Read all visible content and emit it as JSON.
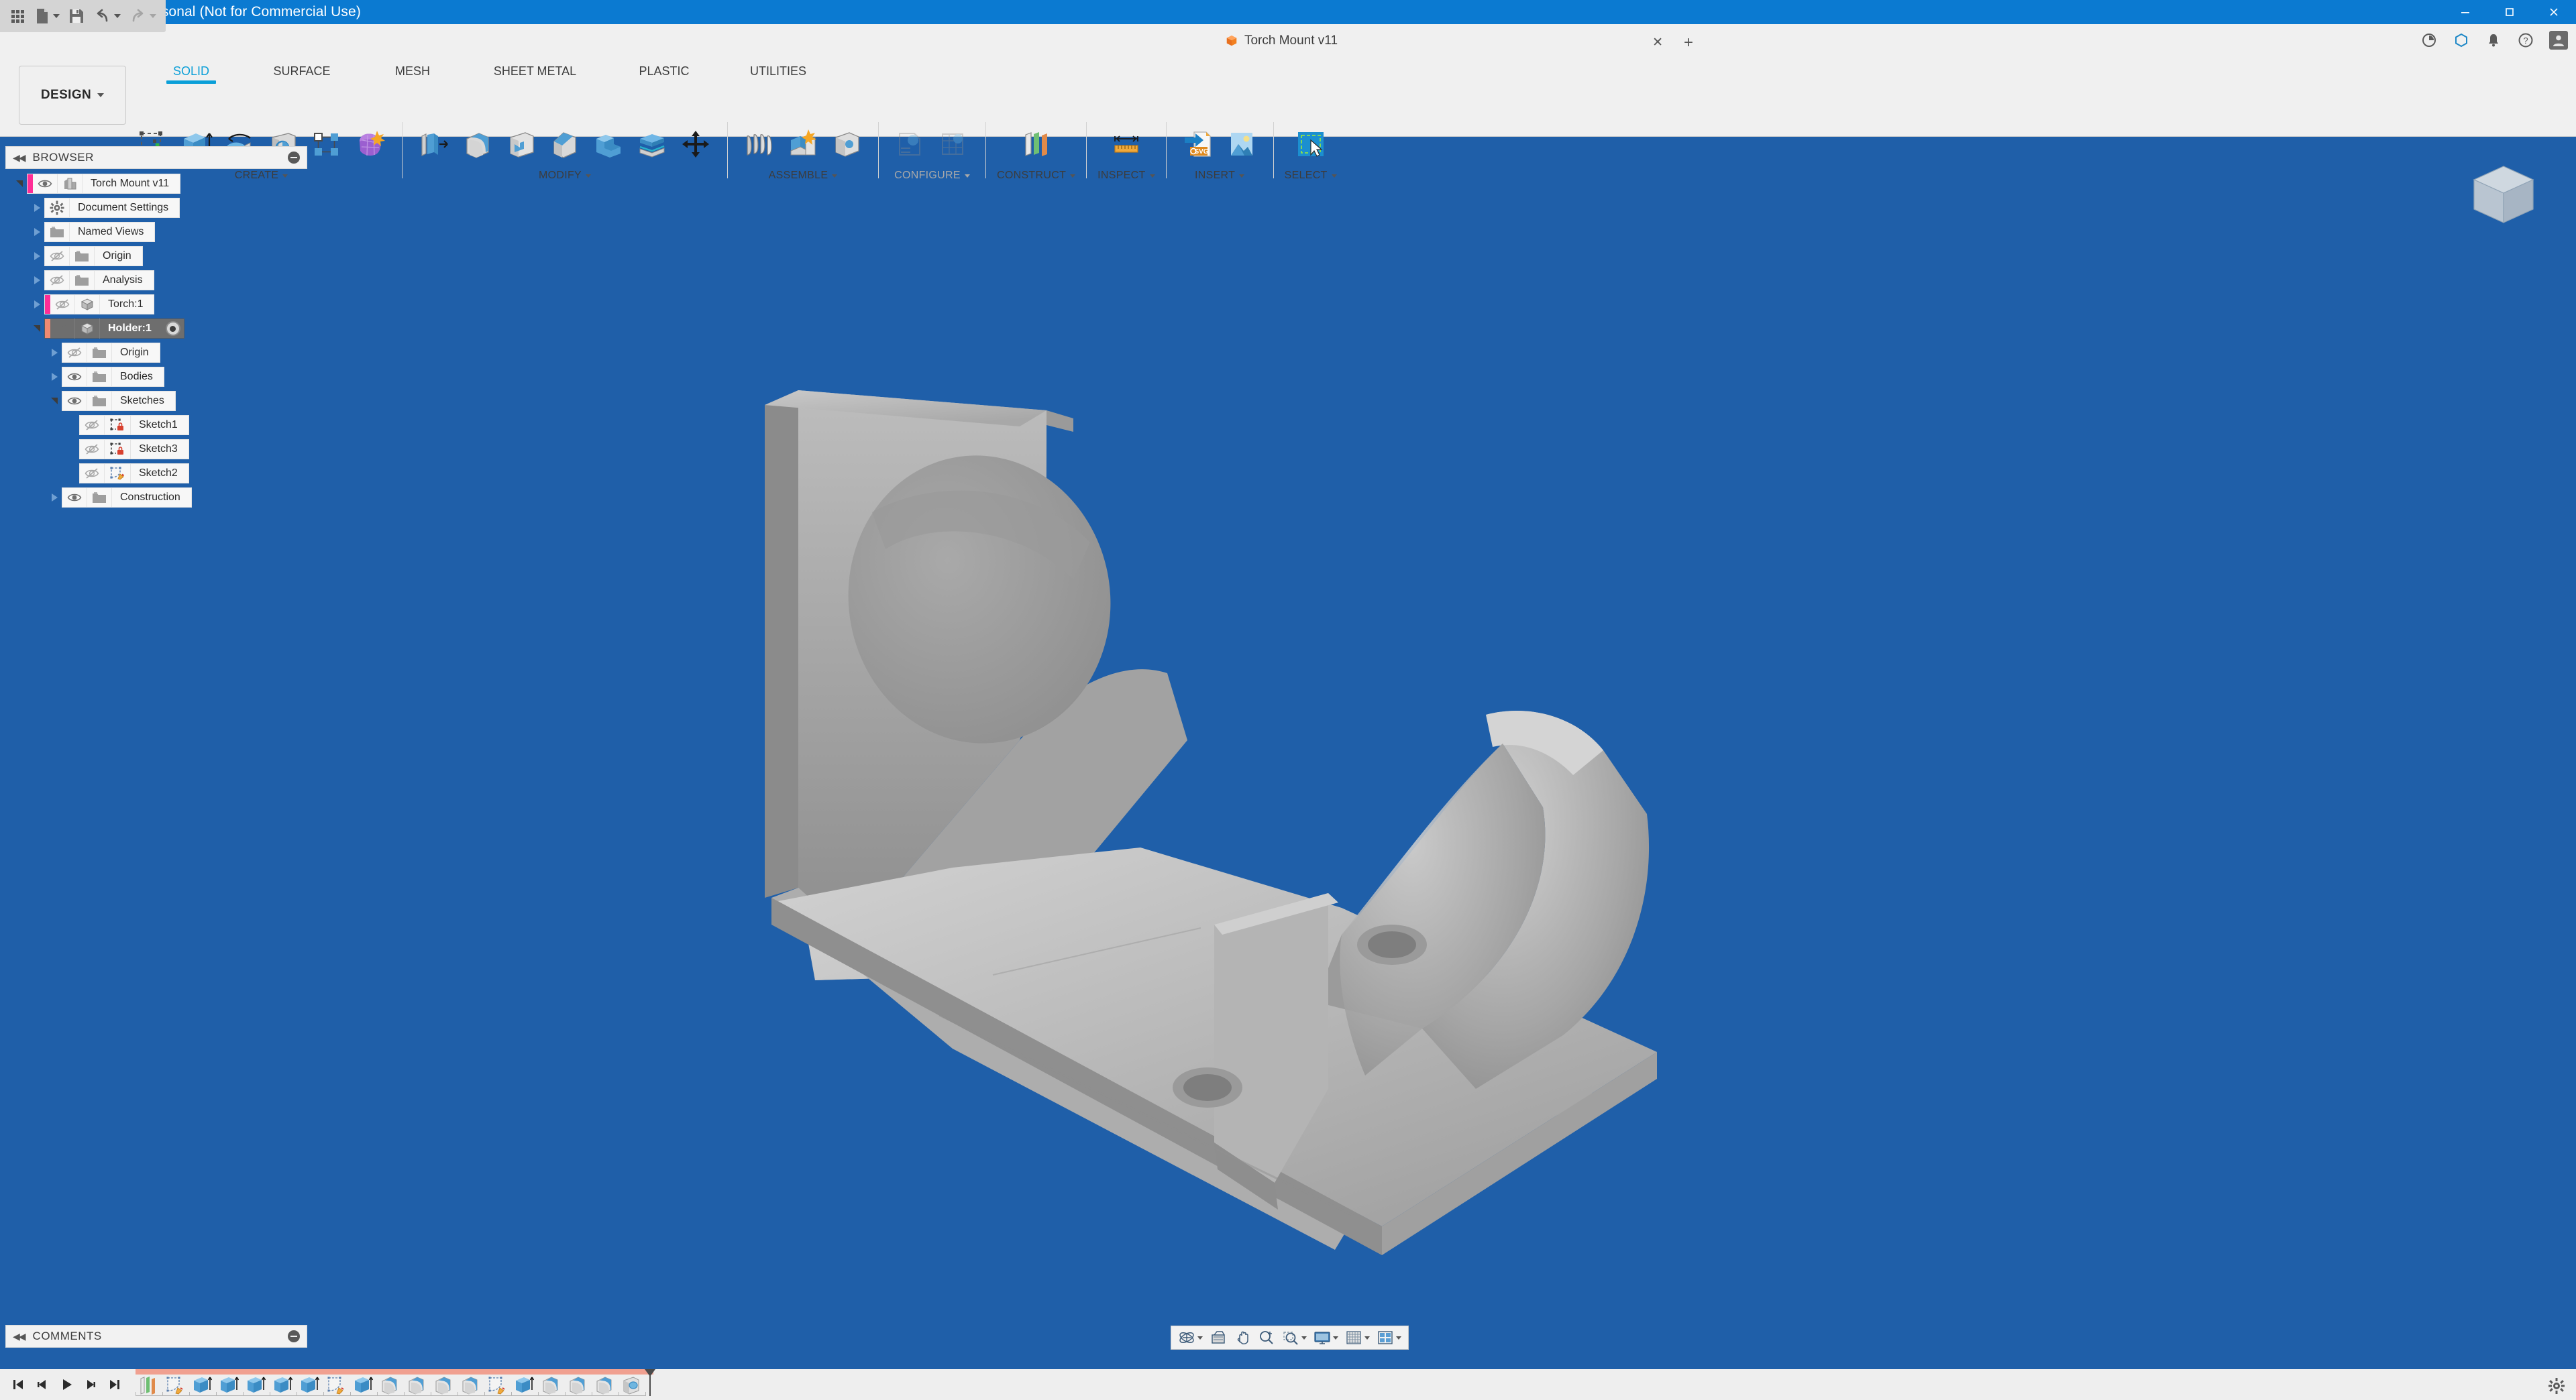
{
  "window": {
    "title": "Autodesk Fusion Personal (Not for Commercial Use)",
    "app_icon": "fusion-logo-icon",
    "minimize": "–",
    "maximize": "□",
    "close": "✕"
  },
  "quick_access": {
    "items": [
      {
        "name": "app-grid-button",
        "icon": "grid-menu-icon",
        "has_caret": false
      },
      {
        "name": "new-file-button",
        "icon": "file-icon",
        "has_caret": true
      },
      {
        "name": "save-button",
        "icon": "save-disk-icon",
        "has_caret": false
      },
      {
        "name": "undo-button",
        "icon": "undo-arrow-icon",
        "has_caret": true
      },
      {
        "name": "redo-button",
        "icon": "redo-arrow-icon",
        "has_caret": true
      }
    ]
  },
  "document_tab": {
    "label": "Torch Mount v11",
    "icon": "orange-cube-icon",
    "close_glyph": "✕",
    "add_glyph": "+"
  },
  "appbar_right": {
    "items": [
      {
        "name": "job-status-icon",
        "glyph": "◔"
      },
      {
        "name": "extensions-icon",
        "glyph": "⬡"
      },
      {
        "name": "notifications-bell-icon",
        "glyph": "🔔"
      },
      {
        "name": "help-icon",
        "glyph": "?"
      },
      {
        "name": "user-avatar",
        "glyph": "👤"
      }
    ]
  },
  "workspace_selector": {
    "label": "DESIGN"
  },
  "ribbon": {
    "tabs": [
      {
        "label": "SOLID",
        "active": true
      },
      {
        "label": "SURFACE",
        "active": false
      },
      {
        "label": "MESH",
        "active": false
      },
      {
        "label": "SHEET METAL",
        "active": false
      },
      {
        "label": "PLASTIC",
        "active": false
      },
      {
        "label": "UTILITIES",
        "active": false
      }
    ],
    "panels": [
      {
        "label": "CREATE",
        "dimmed": false,
        "tools": [
          {
            "name": "create-sketch-tool",
            "icon": "sketch-plus-icon"
          },
          {
            "name": "extrude-tool",
            "icon": "extrude-icon"
          },
          {
            "name": "revolve-tool",
            "icon": "revolve-icon"
          },
          {
            "name": "hole-tool",
            "icon": "hole-icon"
          },
          {
            "name": "rectangular-pattern-tool",
            "icon": "pattern-icon"
          },
          {
            "name": "create-form-tool",
            "icon": "form-sculpt-icon"
          }
        ]
      },
      {
        "label": "MODIFY",
        "dimmed": false,
        "tools": [
          {
            "name": "press-pull-tool",
            "icon": "press-pull-icon"
          },
          {
            "name": "fillet-tool",
            "icon": "fillet-icon"
          },
          {
            "name": "shell-tool",
            "icon": "shell-icon"
          },
          {
            "name": "chamfer-tool",
            "icon": "chamfer-icon"
          },
          {
            "name": "combine-tool",
            "icon": "combine-icon"
          },
          {
            "name": "split-body-tool",
            "icon": "split-body-icon"
          },
          {
            "name": "move-copy-tool",
            "icon": "move-arrows-icon"
          }
        ]
      },
      {
        "label": "ASSEMBLE",
        "dimmed": false,
        "tools": [
          {
            "name": "new-component-tool",
            "icon": "components-icon"
          },
          {
            "name": "joint-tool",
            "icon": "joint-icon"
          },
          {
            "name": "as-built-joint-tool",
            "icon": "as-built-joint-icon"
          }
        ]
      },
      {
        "label": "CONFIGURE",
        "dimmed": true,
        "tools": [
          {
            "name": "configure-design-tool",
            "icon": "configure-design-icon"
          },
          {
            "name": "configure-table-tool",
            "icon": "configure-table-icon"
          }
        ]
      },
      {
        "label": "CONSTRUCT",
        "dimmed": false,
        "tools": [
          {
            "name": "offset-plane-tool",
            "icon": "offset-plane-icon"
          }
        ]
      },
      {
        "label": "INSPECT",
        "dimmed": false,
        "tools": [
          {
            "name": "measure-tool",
            "icon": "measure-ruler-icon"
          }
        ]
      },
      {
        "label": "INSERT",
        "dimmed": false,
        "tools": [
          {
            "name": "insert-svg-tool",
            "icon": "insert-svg-icon"
          },
          {
            "name": "canvas-tool",
            "icon": "insert-image-icon"
          }
        ]
      },
      {
        "label": "SELECT",
        "dimmed": false,
        "tools": [
          {
            "name": "select-tool",
            "icon": "select-cursor-icon"
          }
        ]
      }
    ]
  },
  "browser": {
    "header": "BROWSER",
    "collapse_glyph": "◀◀",
    "nodes": [
      {
        "label": "Torch Mount v11",
        "indent": 0,
        "expander": "open",
        "marker": "pink",
        "visibility": "visible",
        "icon": "document-body-icon",
        "selected": false,
        "activate": false
      },
      {
        "label": "Document Settings",
        "indent": 1,
        "expander": "closed",
        "marker": "none",
        "visibility": "none",
        "icon": "gear-icon",
        "selected": false,
        "activate": false
      },
      {
        "label": "Named Views",
        "indent": 1,
        "expander": "closed",
        "marker": "none",
        "visibility": "none",
        "icon": "folder-icon",
        "selected": false,
        "activate": false
      },
      {
        "label": "Origin",
        "indent": 1,
        "expander": "closed",
        "marker": "none",
        "visibility": "hidden",
        "icon": "folder-icon",
        "selected": false,
        "activate": false
      },
      {
        "label": "Analysis",
        "indent": 1,
        "expander": "closed",
        "marker": "none",
        "visibility": "hidden",
        "icon": "folder-icon",
        "selected": false,
        "activate": false
      },
      {
        "label": "Torch:1",
        "indent": 1,
        "expander": "closed",
        "marker": "pink",
        "visibility": "hidden",
        "icon": "component-icon",
        "selected": false,
        "activate": false
      },
      {
        "label": "Holder:1",
        "indent": 1,
        "expander": "open",
        "marker": "salmon",
        "visibility": "visible",
        "icon": "component-icon",
        "selected": true,
        "activate": true
      },
      {
        "label": "Origin",
        "indent": 2,
        "expander": "closed",
        "marker": "none",
        "visibility": "hidden",
        "icon": "folder-icon",
        "selected": false,
        "activate": false
      },
      {
        "label": "Bodies",
        "indent": 2,
        "expander": "closed",
        "marker": "none",
        "visibility": "visible",
        "icon": "folder-icon",
        "selected": false,
        "activate": false
      },
      {
        "label": "Sketches",
        "indent": 2,
        "expander": "open",
        "marker": "none",
        "visibility": "visible",
        "icon": "folder-icon",
        "selected": false,
        "activate": false
      },
      {
        "label": "Sketch1",
        "indent": 3,
        "expander": "none",
        "marker": "none",
        "visibility": "hidden",
        "icon": "sketch-locked-icon",
        "selected": false,
        "activate": false
      },
      {
        "label": "Sketch3",
        "indent": 3,
        "expander": "none",
        "marker": "none",
        "visibility": "hidden",
        "icon": "sketch-locked-icon",
        "selected": false,
        "activate": false
      },
      {
        "label": "Sketch2",
        "indent": 3,
        "expander": "none",
        "marker": "none",
        "visibility": "hidden",
        "icon": "sketch-edit-icon",
        "selected": false,
        "activate": false
      },
      {
        "label": "Construction",
        "indent": 2,
        "expander": "closed",
        "marker": "none",
        "visibility": "visible",
        "icon": "folder-icon",
        "selected": false,
        "activate": false
      }
    ]
  },
  "comments": {
    "header": "COMMENTS",
    "collapse_glyph": "◀◀"
  },
  "viewport": {
    "model_name": "torch-mount-holder-bracket",
    "background_color": "#1f5fa9",
    "model_color": "#b4b4b4",
    "view_cube_label": "view-cube"
  },
  "navigation_bar": {
    "items": [
      {
        "name": "orbit-button",
        "icon": "orbit-icon",
        "has_caret": true
      },
      {
        "name": "look-at-button",
        "icon": "look-at-icon",
        "has_caret": false
      },
      {
        "name": "pan-button",
        "icon": "pan-hand-icon",
        "has_caret": false
      },
      {
        "name": "zoom-button",
        "icon": "zoom-magnifier-icon",
        "has_caret": false
      },
      {
        "name": "zoom-window-button",
        "icon": "zoom-window-icon",
        "has_caret": true
      },
      {
        "name": "display-settings-button",
        "icon": "monitor-icon",
        "has_caret": true
      },
      {
        "name": "grid-snaps-button",
        "icon": "grid-icon",
        "has_caret": true
      },
      {
        "name": "viewport-layout-button",
        "icon": "viewports-icon",
        "has_caret": true
      }
    ]
  },
  "timeline": {
    "playback": [
      {
        "name": "go-to-beginning-button",
        "icon": "skip-start-icon"
      },
      {
        "name": "step-back-button",
        "icon": "step-back-icon"
      },
      {
        "name": "play-button",
        "icon": "play-icon"
      },
      {
        "name": "step-forward-button",
        "icon": "step-forward-icon"
      },
      {
        "name": "go-to-end-button",
        "icon": "skip-end-icon"
      }
    ],
    "features": [
      {
        "name": "timeline-feature-plane",
        "icon": "plane-icon"
      },
      {
        "name": "timeline-feature-sketch",
        "icon": "sketch-edit-icon"
      },
      {
        "name": "timeline-feature-extrude",
        "icon": "extrude-icon"
      },
      {
        "name": "timeline-feature-extrude",
        "icon": "extrude-icon"
      },
      {
        "name": "timeline-feature-extrude",
        "icon": "extrude-icon"
      },
      {
        "name": "timeline-feature-extrude",
        "icon": "extrude-icon"
      },
      {
        "name": "timeline-feature-extrude",
        "icon": "extrude-icon"
      },
      {
        "name": "timeline-feature-sketch",
        "icon": "sketch-edit-icon"
      },
      {
        "name": "timeline-feature-extrude",
        "icon": "extrude-icon"
      },
      {
        "name": "timeline-feature-fillet",
        "icon": "fillet-icon"
      },
      {
        "name": "timeline-feature-fillet",
        "icon": "fillet-icon"
      },
      {
        "name": "timeline-feature-fillet",
        "icon": "fillet-icon"
      },
      {
        "name": "timeline-feature-fillet",
        "icon": "fillet-icon"
      },
      {
        "name": "timeline-feature-sketch",
        "icon": "sketch-edit-icon"
      },
      {
        "name": "timeline-feature-extrude",
        "icon": "extrude-icon"
      },
      {
        "name": "timeline-feature-fillet",
        "icon": "fillet-icon"
      },
      {
        "name": "timeline-feature-fillet",
        "icon": "fillet-icon"
      },
      {
        "name": "timeline-feature-fillet",
        "icon": "fillet-icon"
      },
      {
        "name": "timeline-feature-hole",
        "icon": "hole-icon"
      }
    ],
    "scope_color": "#f0a090",
    "marker_position": "end"
  },
  "settings": {
    "gear": "settings-gear-icon"
  }
}
